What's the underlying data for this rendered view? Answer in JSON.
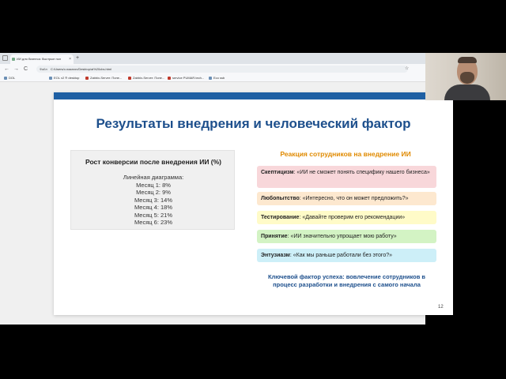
{
  "browser": {
    "tab_title": "ИИ для бизнеса: быстрые пол",
    "tab_close": "×",
    "new_tab": "+",
    "nav_back": "←",
    "nav_forward": "→",
    "nav_reload": "C",
    "omnibox_label": "Файл",
    "url": "C:/Users/o.nazarov/Desktop/ai%20cbs.html",
    "bookmarks": [
      "DOL",
      "EOL v2 ® desktop",
      "Zabbix-Server: Поне...",
      "Zabbix-Server: Поне...",
      "service PUMAR.tech...",
      "Eco ssb"
    ]
  },
  "slide": {
    "title": "Результаты внедрения и человеческий фактор",
    "chart_title": "Рост конверсии после внедрения ИИ (%)",
    "chart_lines": [
      "Линейная диаграмма:",
      "Месяц 1: 8%",
      "Месяц 2: 9%",
      "Месяц 3: 14%",
      "Месяц 4: 18%",
      "Месяц 5: 21%",
      "Месяц 6: 23%"
    ],
    "reactions_title": "Реакция сотрудников на внедрение ИИ",
    "reactions": [
      {
        "label": "Скептицизм",
        "text": ": «ИИ не сможет понять специфику нашего бизнеса»"
      },
      {
        "label": "Любопытство",
        "text": ": «Интересно, что он может предложить?»"
      },
      {
        "label": "Тестирование",
        "text": ": «Давайте проверим его рекомендации»"
      },
      {
        "label": "Принятие",
        "text": ": «ИИ значительно упрощает мою работу»"
      },
      {
        "label": "Энтузиазм",
        "text": ": «Как мы раньше работали без этого?»"
      }
    ],
    "key_factor": "Ключевой фактор успеха: вовлечение сотрудников в процесс разработки и внедрения с самого начала",
    "page_number": "12"
  },
  "colors": {
    "title": "#1d4f8c",
    "accent_bar": "#1e5fa3",
    "reactions_title": "#e08a00",
    "skepticism": "#f8d7da",
    "curiosity": "#fde8cf",
    "testing": "#fffbc8",
    "acceptance": "#d3f3c4",
    "enthusiasm": "#cdeff8"
  }
}
